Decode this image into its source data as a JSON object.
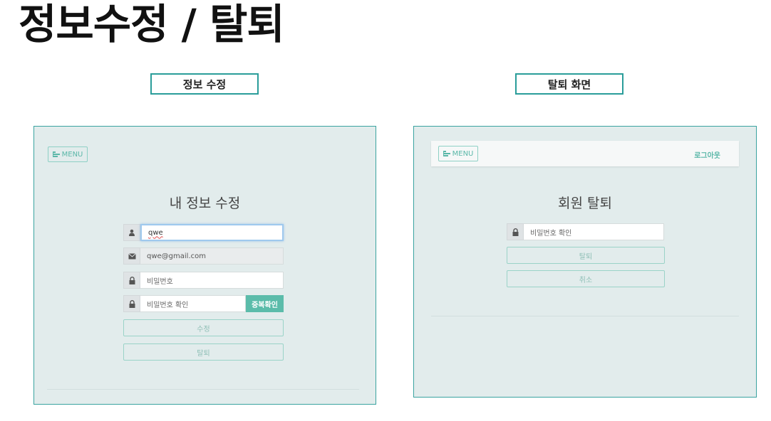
{
  "slide": {
    "title": "정보수정 / 탈퇴"
  },
  "captions": {
    "left": "정보 수정",
    "right": "탈퇴 화면"
  },
  "edit_panel": {
    "menu_label": "MENU",
    "heading": "내 정보 수정",
    "name_value": "qwe",
    "email_value": "qwe@gmail.com",
    "password_placeholder": "비밀번호",
    "password_confirm_placeholder": "비밀번호 확인",
    "duplicate_check_label": "중복확인",
    "edit_button_label": "수정",
    "withdraw_button_label": "탈퇴"
  },
  "withdraw_panel": {
    "menu_label": "MENU",
    "logout_label": "로그아웃",
    "heading": "회원 탈퇴",
    "password_confirm_placeholder": "비밀번호 확인",
    "withdraw_button_label": "탈퇴",
    "cancel_button_label": "취소"
  },
  "icons": {
    "menu": "menu-icon",
    "user": "user-icon",
    "email": "envelope-icon",
    "lock": "lock-icon"
  },
  "colors": {
    "accent": "#5bbcaa",
    "panel_bg": "#e2ecec",
    "panel_border": "#3aa3a0",
    "caption_border": "#2a9d9a"
  }
}
